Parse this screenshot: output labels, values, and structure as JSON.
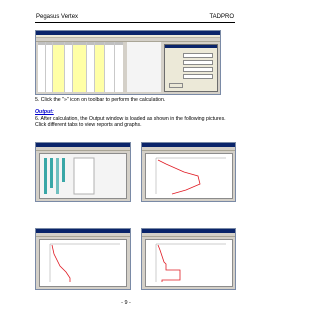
{
  "header": {
    "left": "Pegasus Vertex",
    "right": "TADPRO"
  },
  "step5": "5. Click the \"»\" icon on toolbar to perform the calculation.",
  "output_heading": "Output:",
  "step6": "6. After calculation, the Output window is loaded as shown in the following pictures.  Click different tabs to view reports and graphs.",
  "footer": "- 9 -",
  "icons": [
    "calculate-icon"
  ]
}
